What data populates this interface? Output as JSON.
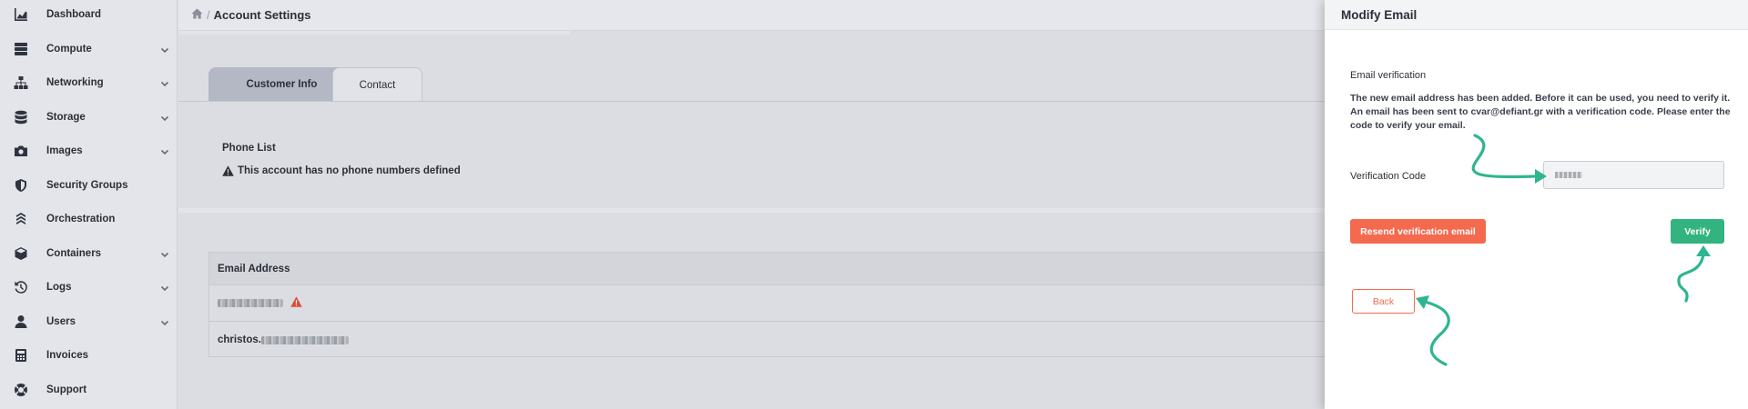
{
  "sidebar": {
    "items": [
      {
        "label": "Dashboard",
        "icon": "chart-area-icon",
        "expandable": false
      },
      {
        "label": "Compute",
        "icon": "server-icon",
        "expandable": true
      },
      {
        "label": "Networking",
        "icon": "sitemap-icon",
        "expandable": true
      },
      {
        "label": "Storage",
        "icon": "database-icon",
        "expandable": true
      },
      {
        "label": "Images",
        "icon": "camera-icon",
        "expandable": true
      },
      {
        "label": "Security Groups",
        "icon": "shield-icon",
        "expandable": false
      },
      {
        "label": "Orchestration",
        "icon": "orchestration-icon",
        "expandable": false
      },
      {
        "label": "Containers",
        "icon": "cube-icon",
        "expandable": true
      },
      {
        "label": "Logs",
        "icon": "history-icon",
        "expandable": true
      },
      {
        "label": "Users",
        "icon": "user-icon",
        "expandable": true
      },
      {
        "label": "Invoices",
        "icon": "calculator-icon",
        "expandable": false
      },
      {
        "label": "Support",
        "icon": "life-ring-icon",
        "expandable": false
      }
    ]
  },
  "breadcrumb": {
    "separator": "/",
    "title": "Account Settings"
  },
  "tabs": {
    "customer_info": "Customer Info",
    "contact": "Contact"
  },
  "phone": {
    "title": "Phone List",
    "warning": "This account has no phone numbers defined"
  },
  "email_table": {
    "header": "Email Address",
    "rows": [
      {
        "prefix": "",
        "verified": false
      },
      {
        "prefix": "christos.",
        "verified": true
      }
    ]
  },
  "panel": {
    "title": "Modify Email",
    "subtitle": "Email verification",
    "message": "The new email address has been added. Before it can be used, you need to verify it. An email has been sent to cvar@defiant.gr with a verification code. Please enter the code to verify your email.",
    "code_label": "Verification Code",
    "resend_label": "Resend verification email",
    "verify_label": "Verify",
    "back_label": "Back"
  },
  "colors": {
    "accent_green": "#33b37f",
    "accent_orange": "#f36a4f",
    "warning_red": "#e14b3b"
  }
}
